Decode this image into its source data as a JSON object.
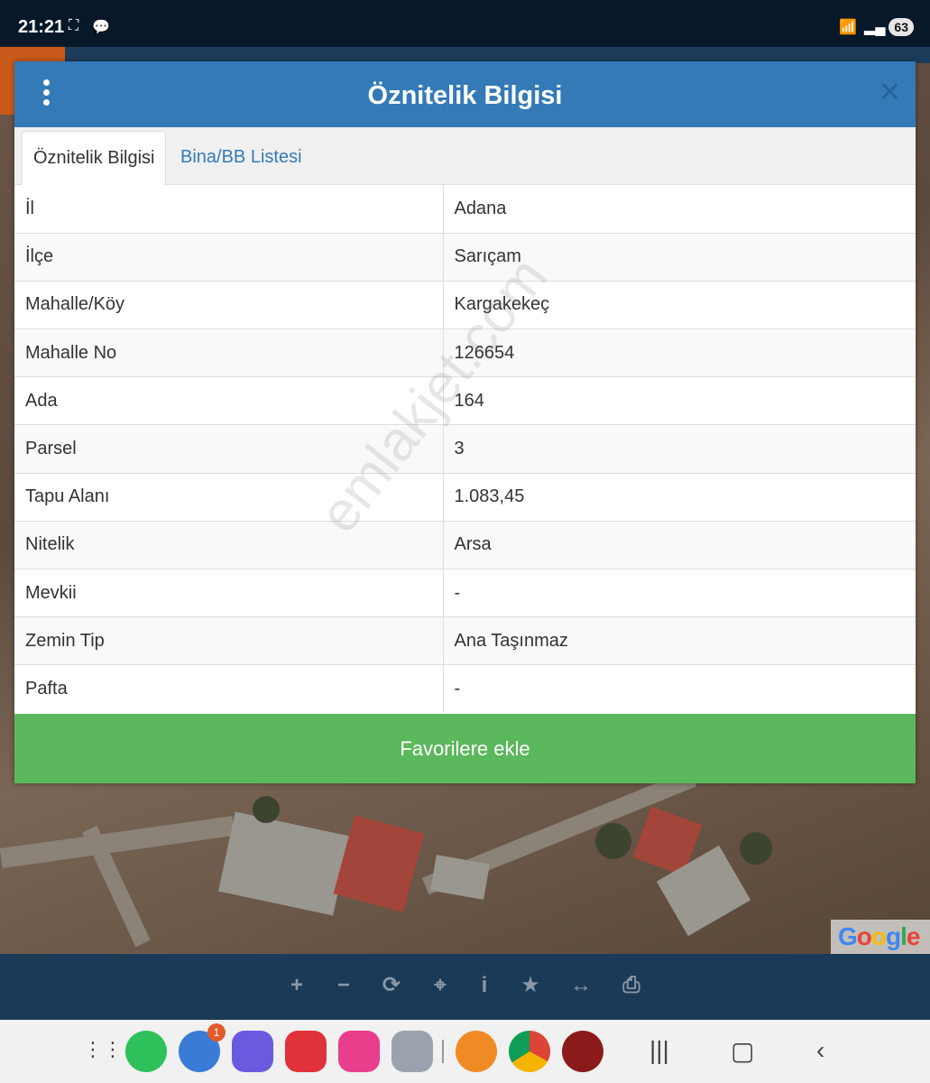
{
  "status": {
    "time": "21:21",
    "battery": "63"
  },
  "modal": {
    "title": "Öznitelik Bilgisi",
    "tabs": [
      {
        "label": "Öznitelik Bilgisi",
        "active": true
      },
      {
        "label": "Bina/BB Listesi",
        "active": false
      }
    ],
    "rows": [
      {
        "key": "İl",
        "value": "Adana"
      },
      {
        "key": "İlçe",
        "value": "Sarıçam"
      },
      {
        "key": "Mahalle/Köy",
        "value": "Kargakekeç"
      },
      {
        "key": "Mahalle No",
        "value": "126654"
      },
      {
        "key": "Ada",
        "value": "164"
      },
      {
        "key": "Parsel",
        "value": "3"
      },
      {
        "key": "Tapu Alanı",
        "value": "1.083,45"
      },
      {
        "key": "Nitelik",
        "value": "Arsa"
      },
      {
        "key": "Mevkii",
        "value": "-"
      },
      {
        "key": "Zemin Tip",
        "value": "Ana Taşınmaz"
      },
      {
        "key": "Pafta",
        "value": "-"
      }
    ],
    "favorite_button": "Favorilere ekle"
  },
  "watermark": "emlakjet.com",
  "map": {
    "attribution": "Google"
  },
  "toolbar": {
    "tools": [
      "plus-icon",
      "minus-icon",
      "refresh-icon",
      "crosshair-icon",
      "info-icon",
      "star-icon",
      "measure-icon",
      "print-icon"
    ]
  },
  "nav": {
    "messages_badge": "1",
    "apps": [
      "apps-grid",
      "phone",
      "messages",
      "internet",
      "notes",
      "gallery",
      "camera",
      "emlak-app",
      "chrome",
      "m-app"
    ]
  },
  "colors": {
    "header": "#337ab7",
    "favorite": "#5cb85c",
    "toolbar": "#1b3a57"
  }
}
